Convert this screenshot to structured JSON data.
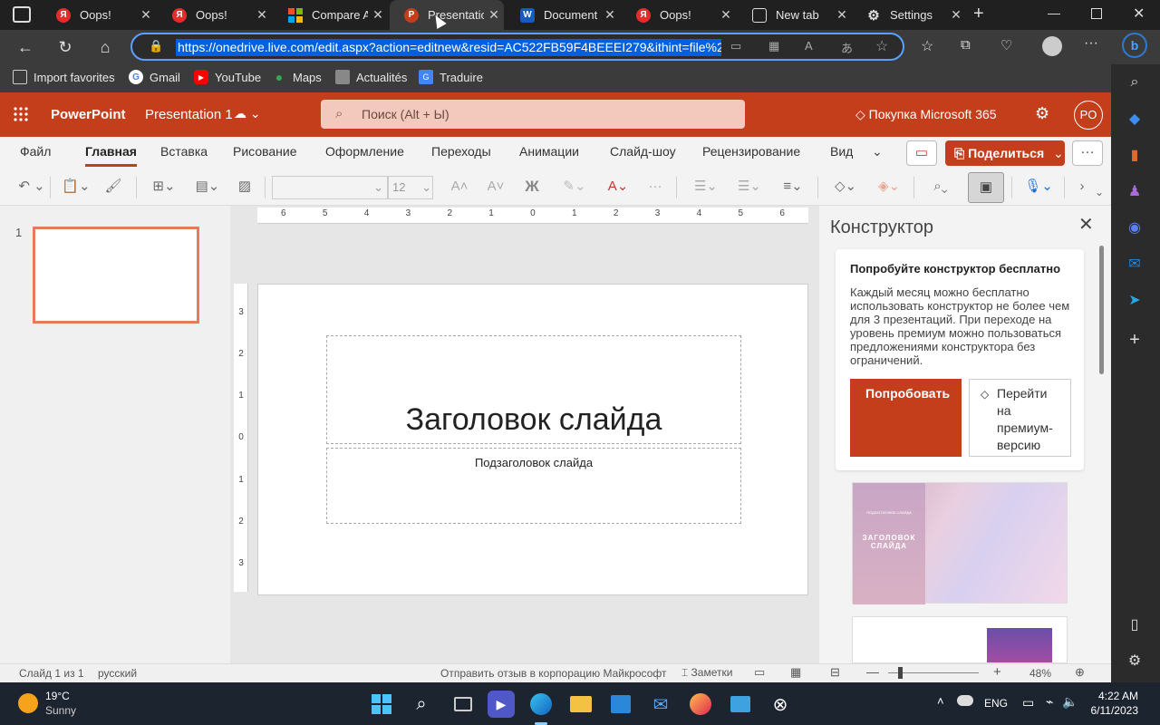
{
  "browser": {
    "tabs": [
      {
        "title": "Oops!",
        "icon": "yandex-icon"
      },
      {
        "title": "Oops!",
        "icon": "yandex-icon"
      },
      {
        "title": "Compare All",
        "icon": "microsoft-icon"
      },
      {
        "title": "Presentation",
        "icon": "powerpoint-icon"
      },
      {
        "title": "Document",
        "icon": "word-icon"
      },
      {
        "title": "Oops!",
        "icon": "yandex-icon"
      },
      {
        "title": "New tab",
        "icon": "newtab-icon"
      },
      {
        "title": "Settings",
        "icon": "gear-icon"
      }
    ],
    "url": "https://onedrive.live.com/edit.aspx?action=editnew&resid=AC522FB59F4BEEEI279&ithint=file%2c",
    "favorites": [
      {
        "label": "Import favorites"
      },
      {
        "label": "Gmail"
      },
      {
        "label": "YouTube"
      },
      {
        "label": "Maps"
      },
      {
        "label": "Actualités"
      },
      {
        "label": "Traduire"
      }
    ]
  },
  "app": {
    "name": "PowerPoint",
    "doc_title": "Presentation 1",
    "search_placeholder": "Поиск (Alt + Ы)",
    "premium_label": "Покупка Microsoft 365",
    "avatar": "PO",
    "ribbon_tabs": [
      "Файл",
      "Главная",
      "Вставка",
      "Рисование",
      "Оформление",
      "Переходы",
      "Анимации",
      "Слайд-шоу",
      "Рецензирование",
      "Вид"
    ],
    "active_tab": "Главная",
    "share_label": "Поделиться",
    "font_size": "12",
    "bold_label": "Ж"
  },
  "slides": {
    "thumb_number": "1",
    "title": "Заголовок слайда",
    "subtitle": "Подзаголовок слайда"
  },
  "ruler": {
    "h_labels": [
      "6",
      "5",
      "4",
      "3",
      "2",
      "1",
      "0",
      "1",
      "2",
      "3",
      "4",
      "5",
      "6"
    ],
    "v_labels": [
      "3",
      "2",
      "1",
      "0",
      "1",
      "2",
      "3"
    ]
  },
  "designer": {
    "title": "Конструктор",
    "card_heading": "Попробуйте конструктор бесплатно",
    "card_body": "Каждый месяц можно бесплатно использовать конструктор не более чем для 3 презентаций. При переходе на уровень премиум можно пользоваться предложениями конструктора без ограничений.",
    "try_button": "Попробовать",
    "premium_button": "Перейти на премиум-версию",
    "preview_text": "ЗАГОЛОВОК СЛАЙДА",
    "preview_small": "ПОДЗАГОЛОВОК СЛАЙДА"
  },
  "status": {
    "slide_info": "Слайд 1 из 1",
    "language": "русский",
    "feedback": "Отправить отзыв в корпорацию Майкрософт",
    "notes": "Заметки",
    "zoom": "48%"
  },
  "taskbar": {
    "weather_temp": "19°C",
    "weather_desc": "Sunny",
    "lang": "ENG",
    "time": "4:22 AM",
    "date": "6/11/2023"
  },
  "colors": {
    "brand": "#c43e1c",
    "accent": "#0060df"
  }
}
